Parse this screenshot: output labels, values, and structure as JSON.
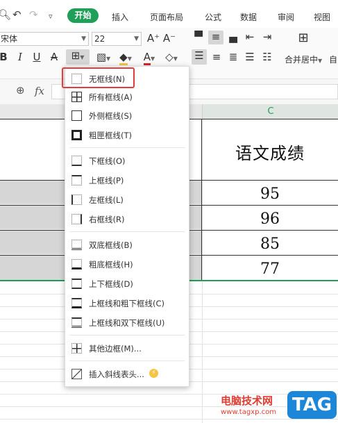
{
  "colors": {
    "accent": "#1f9f58",
    "highlight_box": "#e23b3b",
    "watermark": "#e03c32",
    "watermark_logo_bg": "#1c86d8"
  },
  "toolbar": {
    "tabs": [
      "开始",
      "插入",
      "页面布局",
      "公式",
      "数据",
      "审阅",
      "视图"
    ],
    "active_tab": "开始",
    "font_name": "宋体",
    "font_size": "22",
    "grow_font": "A⁺",
    "shrink_font": "A⁻",
    "merge_label": "合并居中",
    "auto_label": "自",
    "fx_label": "fx"
  },
  "sheet": {
    "column_label": "C",
    "header_value": "语文成绩",
    "scores": [
      "95",
      "96",
      "85",
      "77"
    ]
  },
  "border_menu": {
    "items": [
      {
        "label": "无框线(N)",
        "icon": "no-border-icon"
      },
      {
        "label": "所有框线(A)",
        "icon": "all-borders-icon"
      },
      {
        "label": "外侧框线(S)",
        "icon": "outside-borders-icon"
      },
      {
        "label": "粗匣框线(T)",
        "icon": "thick-box-border-icon"
      },
      {
        "label": "下框线(O)",
        "icon": "bottom-border-icon"
      },
      {
        "label": "上框线(P)",
        "icon": "top-border-icon"
      },
      {
        "label": "左框线(L)",
        "icon": "left-border-icon"
      },
      {
        "label": "右框线(R)",
        "icon": "right-border-icon"
      },
      {
        "label": "双底框线(B)",
        "icon": "double-bottom-border-icon"
      },
      {
        "label": "粗底框线(H)",
        "icon": "thick-bottom-border-icon"
      },
      {
        "label": "上下框线(D)",
        "icon": "top-bottom-border-icon"
      },
      {
        "label": "上框线和粗下框线(C)",
        "icon": "top-thick-bottom-border-icon"
      },
      {
        "label": "上框线和双下框线(U)",
        "icon": "top-double-bottom-border-icon"
      },
      {
        "label": "其他边框(M)...",
        "icon": "more-borders-icon"
      },
      {
        "label": "插入斜线表头...",
        "icon": "diagonal-header-icon"
      }
    ]
  },
  "watermark": {
    "site_name": "电脑技术网",
    "url": "www.tagxp.com",
    "logo_text": "TAG"
  }
}
